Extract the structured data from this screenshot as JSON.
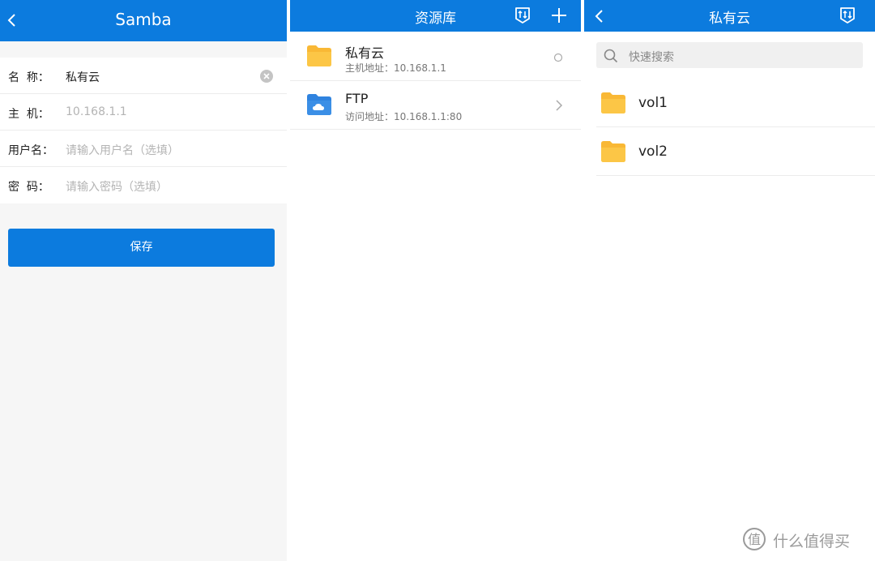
{
  "samba_panel": {
    "title": "Samba",
    "form": [
      {
        "label": "名  称：",
        "value": "私有云",
        "placeholder": ""
      },
      {
        "label": "主  机：",
        "value": "",
        "placeholder": "10.168.1.1"
      },
      {
        "label": "用户名：",
        "value": "",
        "placeholder": "请输入用户名（选填）"
      },
      {
        "label": "密  码：",
        "value": "",
        "placeholder": "请输入密码（选填）"
      }
    ],
    "save_label": "保存"
  },
  "library_panel": {
    "title": "资源库",
    "items": [
      {
        "name": "私有云",
        "subtitle": "主机地址：10.168.1.1",
        "icon": "folder-icon",
        "trailing": "radio-icon"
      },
      {
        "name": "FTP",
        "subtitle": "访问地址：10.168.1.1:80",
        "icon": "cloud-folder-icon",
        "trailing": "chevron-right-icon"
      }
    ]
  },
  "cloud_panel": {
    "title": "私有云",
    "search_placeholder": "快速搜索",
    "folders": [
      {
        "name": "vol1",
        "icon": "folder-icon"
      },
      {
        "name": "vol2",
        "icon": "folder-icon"
      }
    ]
  },
  "watermark": {
    "text": "什么值得买",
    "icon": "smzdm-logo-icon"
  },
  "colors": {
    "accent": "#0c7bde",
    "folder": "#f9b835",
    "cloud_folder": "#3b8fe6",
    "background": "#f6f6f6"
  }
}
